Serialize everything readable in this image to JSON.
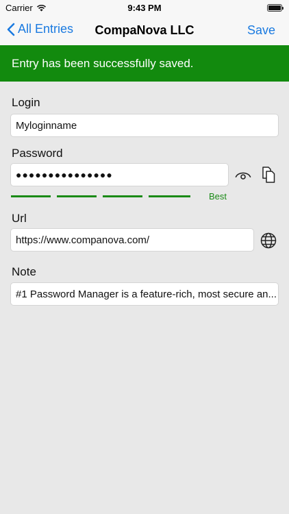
{
  "status": {
    "carrier": "Carrier",
    "time": "9:43 PM"
  },
  "nav": {
    "back_label": "All Entries",
    "title": "CompaNova LLC",
    "save_label": "Save"
  },
  "toast": {
    "message": "Entry has been successfully saved."
  },
  "form": {
    "login": {
      "label": "Login",
      "value": "Myloginname"
    },
    "password": {
      "label": "Password",
      "value": "●●●●●●●●●●●●●●●",
      "strength_label": "Best",
      "strength_level": "4 of 4"
    },
    "url": {
      "label": "Url",
      "value": "https://www.companova.com/"
    },
    "note": {
      "label": "Note",
      "value": "#1 Password Manager is a feature-rich, most secure an..."
    }
  },
  "icons": {
    "back": "chevron-left-icon",
    "reveal": "eye-icon",
    "copy": "copy-icon",
    "open_url": "globe-icon",
    "wifi": "wifi-icon",
    "battery": "battery-icon"
  },
  "colors": {
    "accent": "#1a7ae0",
    "success": "#128a0e",
    "strength": "#1a8a16",
    "background": "#e8e8e8"
  }
}
